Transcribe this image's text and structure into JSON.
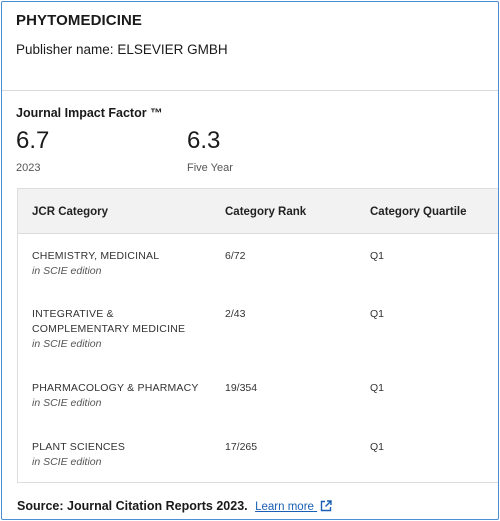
{
  "journal": {
    "title": "PHYTOMEDICINE",
    "publisher_label": "Publisher name:",
    "publisher_name": "ELSEVIER GMBH"
  },
  "impact_factor": {
    "heading": "Journal Impact Factor ™",
    "metrics": [
      {
        "value": "6.7",
        "caption": "2023"
      },
      {
        "value": "6.3",
        "caption": "Five Year"
      }
    ]
  },
  "jcr_table": {
    "headers": [
      "JCR Category",
      "Category Rank",
      "Category Quartile"
    ],
    "rows": [
      {
        "category": "CHEMISTRY, MEDICINAL",
        "edition": "in SCIE edition",
        "rank": "6/72",
        "quartile": "Q1"
      },
      {
        "category": "INTEGRATIVE & COMPLEMENTARY MEDICINE",
        "edition": "in SCIE edition",
        "rank": "2/43",
        "quartile": "Q1"
      },
      {
        "category": "PHARMACOLOGY & PHARMACY",
        "edition": "in SCIE edition",
        "rank": "19/354",
        "quartile": "Q1"
      },
      {
        "category": "PLANT SCIENCES",
        "edition": "in SCIE edition",
        "rank": "17/265",
        "quartile": "Q1"
      }
    ]
  },
  "source": {
    "label": "Source: Journal Citation Reports",
    "year": "2023.",
    "link_text": "Learn more",
    "link_icon": "external-link-icon"
  },
  "colors": {
    "frame_border": "#4a8fd6",
    "link": "#1a5fb4",
    "table_header_bg": "#f2f2f2"
  }
}
